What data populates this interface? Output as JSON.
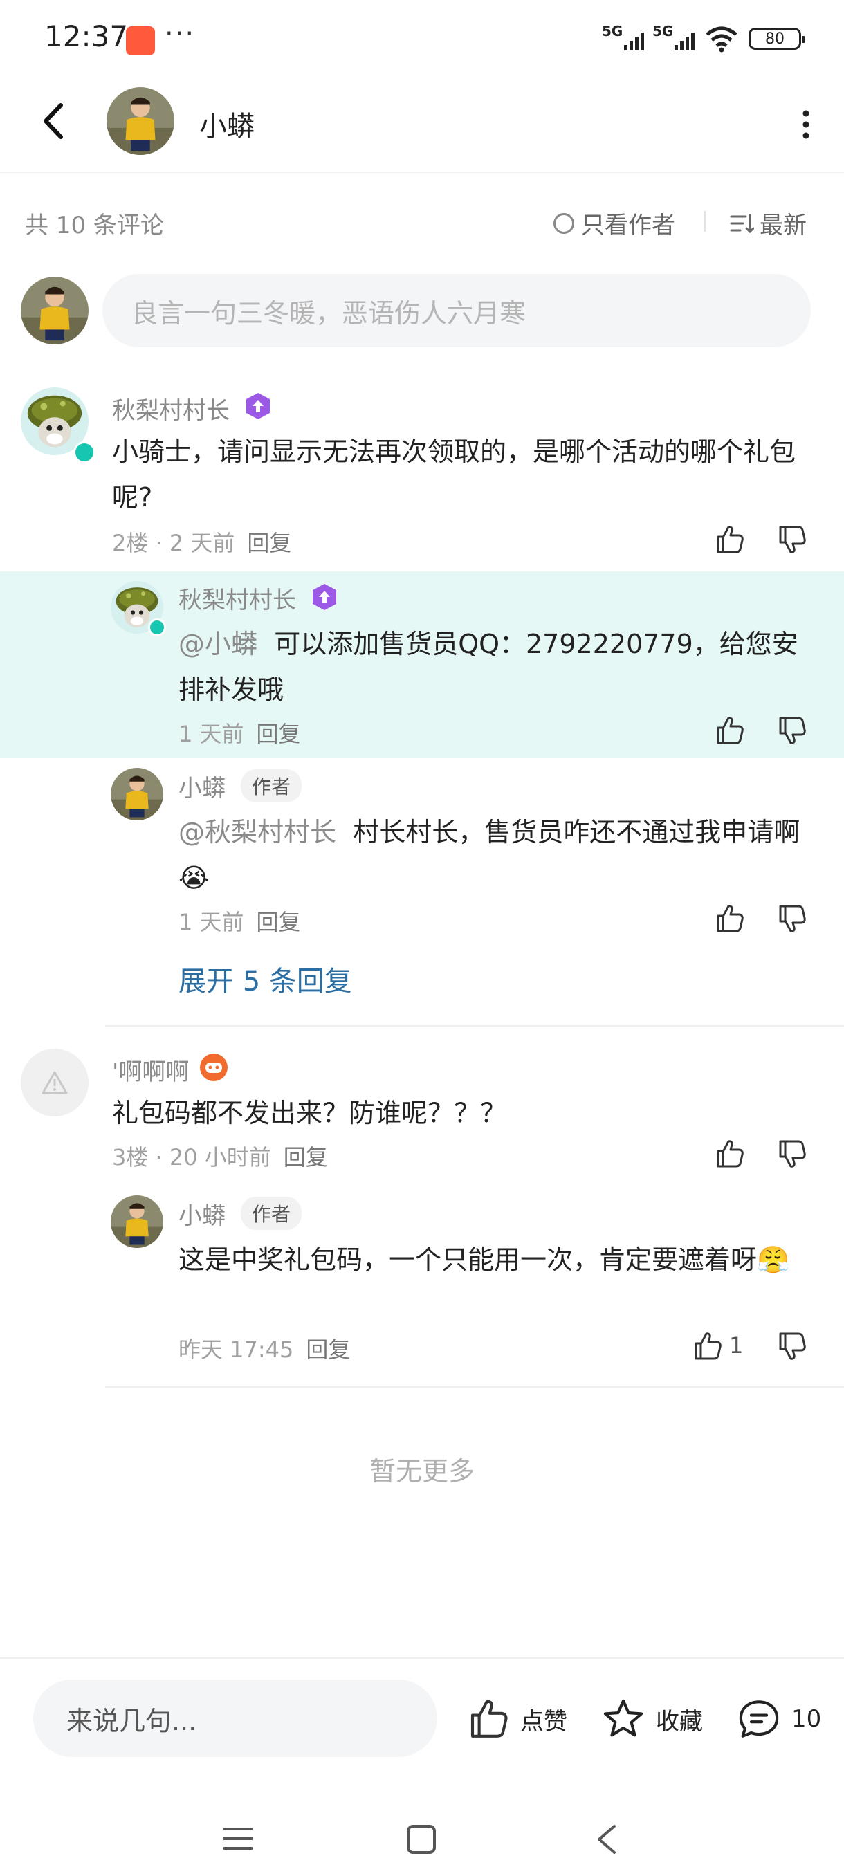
{
  "status_bar": {
    "time": "12:37",
    "more": "···",
    "network_1": "5G",
    "network_2": "5G",
    "battery": "80"
  },
  "header": {
    "title": "小蟒"
  },
  "comments_bar": {
    "count_text": "共 10 条评论",
    "author_only_label": "只看作者",
    "sort_label": "最新"
  },
  "input": {
    "placeholder": "良言一句三冬暖，恶语伤人六月寒"
  },
  "comments": [
    {
      "name": "秋梨村村长",
      "text": "小骑士，请问显示无法再次领取的，是哪个活动的哪个礼包呢?",
      "floor_time": "2楼 · 2 天前",
      "reply_label": "回复",
      "replies": [
        {
          "name": "秋梨村村长",
          "mention": "@小蟒",
          "text": "可以添加售货员QQ：2792220779，给您安排补发哦",
          "time": "1 天前",
          "reply_label": "回复"
        },
        {
          "name": "小蟒",
          "author_tag": "作者",
          "mention": "@秋梨村村长",
          "text": "村长村长，售货员咋还不通过我申请啊😭",
          "time": "1 天前",
          "reply_label": "回复"
        }
      ],
      "expand_label": "展开 5 条回复"
    },
    {
      "name": "'啊啊啊",
      "text": "礼包码都不发出来？防谁呢？？？",
      "floor_time": "3楼 · 20 小时前",
      "reply_label": "回复",
      "replies": [
        {
          "name": "小蟒",
          "author_tag": "作者",
          "text": "这是中奖礼包码，一个只能用一次，肯定要遮着呀😤",
          "time": "昨天 17:45",
          "reply_label": "回复",
          "likes": "1"
        }
      ]
    }
  ],
  "no_more": "暂无更多",
  "bottom_bar": {
    "input_placeholder": "来说几句...",
    "like_label": "点赞",
    "favorite_label": "收藏",
    "comment_count": "10"
  },
  "colors": {
    "highlight_bg": "#e6f8f6",
    "link": "#2b6ea3",
    "badge_purple": "#9b59e6",
    "badge_orange": "#f26b2e",
    "verified_teal": "#17c6b0"
  }
}
